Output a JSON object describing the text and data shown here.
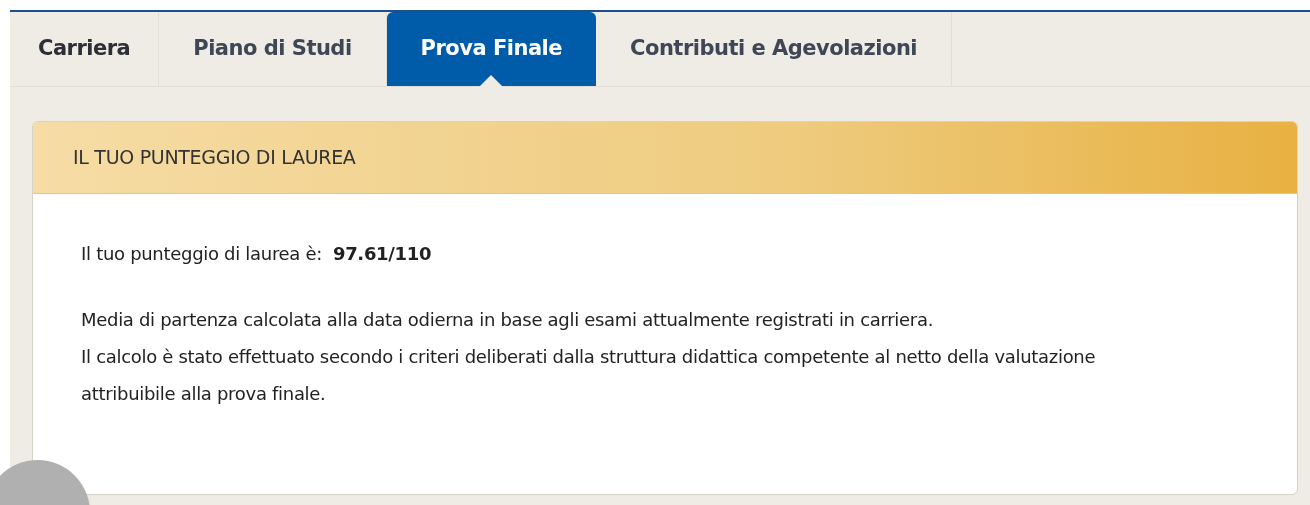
{
  "tabs": [
    {
      "label": "Carriera",
      "selected": false
    },
    {
      "label": "Piano di Studi",
      "selected": false
    },
    {
      "label": "Prova Finale",
      "selected": true
    },
    {
      "label": "Contributi e Agevolazioni",
      "selected": false
    }
  ],
  "card": {
    "title": "IL TUO PUNTEGGIO DI LAUREA",
    "score_line": "Il tuo punteggio di laurea è:  **97.61/110**",
    "notes": [
      "Media di partenza calcolata alla data odierna in base agli esami attualmente registrati in carriera.",
      "Il calcolo è stato effettuato secondo i criteri deliberati dalla struttura didattica competente al netto della valutazione attribuibile alla prova finale."
    ]
  }
}
